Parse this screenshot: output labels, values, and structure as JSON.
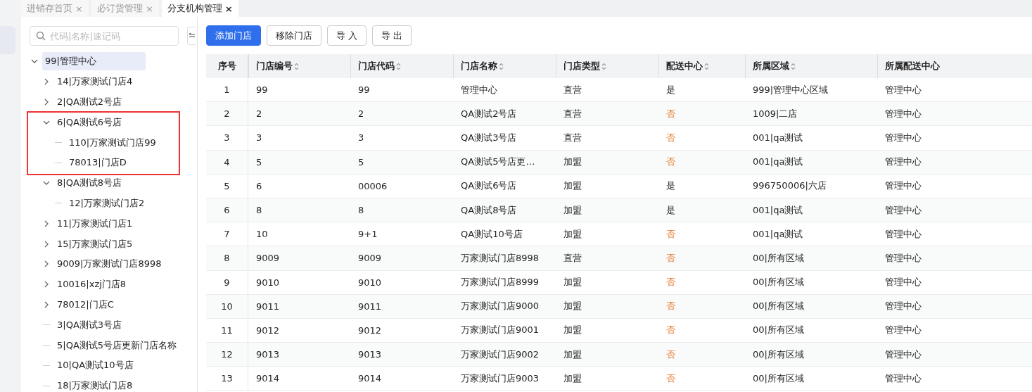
{
  "tabs": [
    {
      "label": "进销存首页",
      "close": "×",
      "selected": false
    },
    {
      "label": "必订货管理",
      "close": "×",
      "selected": false
    },
    {
      "label": "分支机构管理",
      "close": "×",
      "selected": true
    }
  ],
  "tree": {
    "search": {
      "placeholder": "代码|名称|速记码"
    },
    "nodes": [
      {
        "label": "99|管理中心",
        "selected": true,
        "expanded": true,
        "children": [
          {
            "label": "14|万家测试门店4",
            "selected": false,
            "expanded": false
          },
          {
            "label": "2|QA测试2号店",
            "selected": false,
            "expanded": false
          },
          {
            "label": "6|QA测试6号店",
            "selected": false,
            "expanded": true,
            "highlighted": true,
            "children": [
              {
                "label": "110|万家测试门店99",
                "selected": false
              },
              {
                "label": "78013|门店D",
                "selected": false
              }
            ]
          },
          {
            "label": "8|QA测试8号店",
            "selected": false,
            "expanded": true,
            "children": [
              {
                "label": "12|万家测试门店2",
                "selected": false
              }
            ]
          },
          {
            "label": "11|万家测试门店1",
            "selected": false,
            "expanded": false
          },
          {
            "label": "15|万家测试门店5",
            "selected": false,
            "expanded": false
          },
          {
            "label": "9009|万家测试门店8998",
            "selected": false,
            "expanded": false
          },
          {
            "label": "10016|xzj门店8",
            "selected": false,
            "expanded": false
          },
          {
            "label": "78012|门店C",
            "selected": false,
            "expanded": false
          },
          {
            "label": "3|QA测试3号店",
            "selected": false
          },
          {
            "label": "5|QA测试5号店更新门店名称",
            "selected": false
          },
          {
            "label": "10|QA测试10号店",
            "selected": false
          },
          {
            "label": "18|万家测试门店8",
            "selected": false
          }
        ]
      }
    ]
  },
  "toolbar": [
    {
      "label": "添加门店",
      "kind": "primary"
    },
    {
      "label": "移除门店",
      "kind": "default"
    },
    {
      "label": "导 入",
      "kind": "default"
    },
    {
      "label": "导 出",
      "kind": "default"
    }
  ],
  "table": {
    "columns": [
      {
        "label": "序号",
        "sortable": false,
        "kind": "index"
      },
      {
        "label": "门店编号",
        "sortable": true,
        "kind": "text"
      },
      {
        "label": "门店代码",
        "sortable": true,
        "kind": "text"
      },
      {
        "label": "门店名称",
        "sortable": true,
        "kind": "text"
      },
      {
        "label": "门店类型",
        "sortable": true,
        "kind": "text"
      },
      {
        "label": "配送中心",
        "sortable": true,
        "kind": "flag"
      },
      {
        "label": "所属区域",
        "sortable": true,
        "kind": "text"
      },
      {
        "label": "所属配送中心",
        "sortable": false,
        "kind": "text"
      }
    ],
    "rows": [
      {
        "cells": [
          "1",
          "99",
          "99",
          "管理中心",
          "直营",
          "是",
          "999|管理中心区域",
          "管理中心"
        ],
        "flag_negative": false
      },
      {
        "cells": [
          "2",
          "2",
          "2",
          "QA测试2号店",
          "直营",
          "否",
          "1009|二店",
          "管理中心"
        ],
        "flag_negative": true
      },
      {
        "cells": [
          "3",
          "3",
          "3",
          "QA测试3号店",
          "直营",
          "否",
          "001|qa测试",
          "管理中心"
        ],
        "flag_negative": true
      },
      {
        "cells": [
          "4",
          "5",
          "5",
          "QA测试5号店更…",
          "加盟",
          "否",
          "001|qa测试",
          "管理中心"
        ],
        "flag_negative": true
      },
      {
        "cells": [
          "5",
          "6",
          "00006",
          "QA测试6号店",
          "加盟",
          "是",
          "996750006|六店",
          "管理中心"
        ],
        "flag_negative": false
      },
      {
        "cells": [
          "6",
          "8",
          "8",
          "QA测试8号店",
          "加盟",
          "是",
          "001|qa测试",
          "管理中心"
        ],
        "flag_negative": false
      },
      {
        "cells": [
          "7",
          "10",
          "9+1",
          "QA测试10号店",
          "加盟",
          "否",
          "001|qa测试",
          "管理中心"
        ],
        "flag_negative": true
      },
      {
        "cells": [
          "8",
          "9009",
          "9009",
          "万家测试门店8998",
          "直营",
          "否",
          "00|所有区域",
          "管理中心"
        ],
        "flag_negative": true
      },
      {
        "cells": [
          "9",
          "9010",
          "9010",
          "万家测试门店8999",
          "加盟",
          "否",
          "00|所有区域",
          "管理中心"
        ],
        "flag_negative": true
      },
      {
        "cells": [
          "10",
          "9011",
          "9011",
          "万家测试门店9000",
          "加盟",
          "否",
          "00|所有区域",
          "管理中心"
        ],
        "flag_negative": true
      },
      {
        "cells": [
          "11",
          "9012",
          "9012",
          "万家测试门店9001",
          "加盟",
          "否",
          "00|所有区域",
          "管理中心"
        ],
        "flag_negative": true
      },
      {
        "cells": [
          "12",
          "9013",
          "9013",
          "万家测试门店9002",
          "加盟",
          "否",
          "00|所有区域",
          "管理中心"
        ],
        "flag_negative": true
      },
      {
        "cells": [
          "13",
          "9014",
          "9014",
          "万家测试门店9003",
          "加盟",
          "否",
          "00|所有区域",
          "管理中心"
        ],
        "flag_negative": true
      }
    ]
  }
}
